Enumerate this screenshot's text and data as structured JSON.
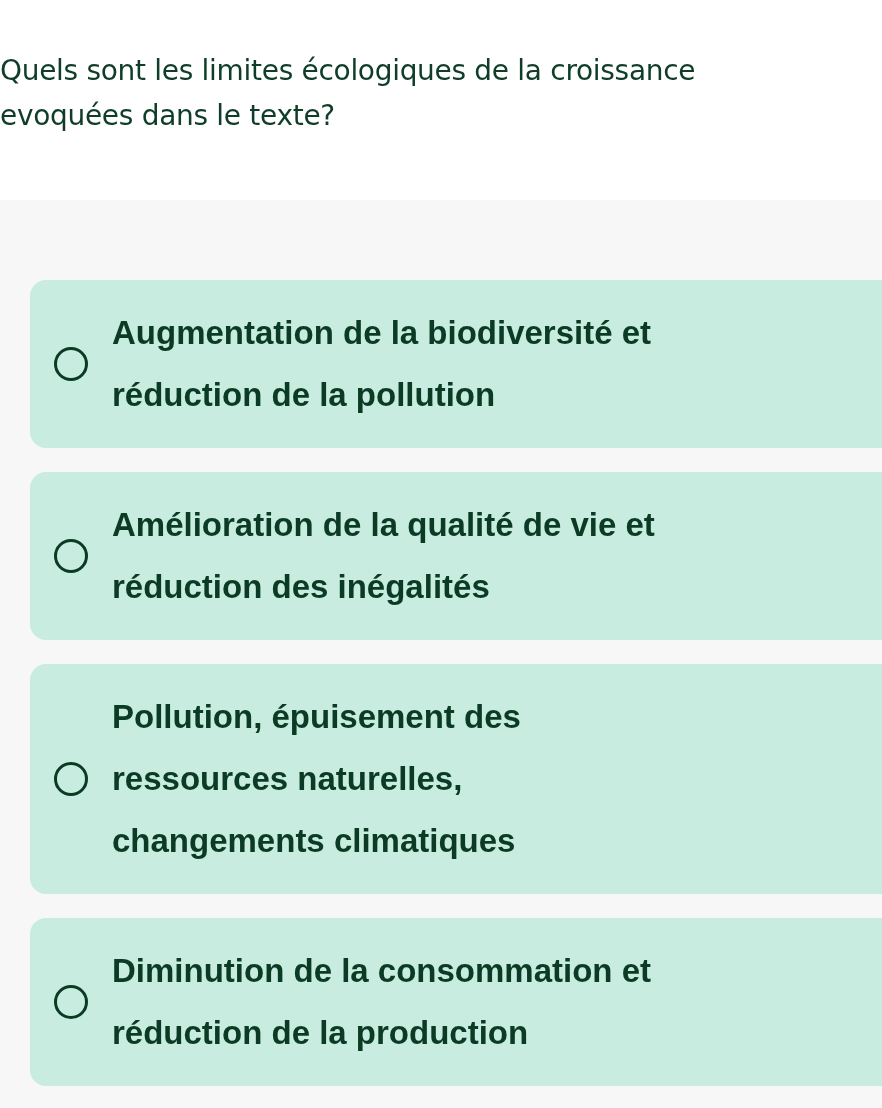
{
  "question": {
    "lines": [
      "Quels sont les limites écologiques de la croissance",
      "evoquées dans le texte?"
    ]
  },
  "options": [
    {
      "label": "Augmentation de la biodiversité et réduction de la pollution",
      "selected": false
    },
    {
      "label": "Amélioration de la qualité de vie et réduction des inégalités",
      "selected": false
    },
    {
      "label": "Pollution, épuisement des ressources naturelles, changements climatiques",
      "selected": false
    },
    {
      "label": "Diminution de la consommation et réduction de la production",
      "selected": false
    }
  ]
}
